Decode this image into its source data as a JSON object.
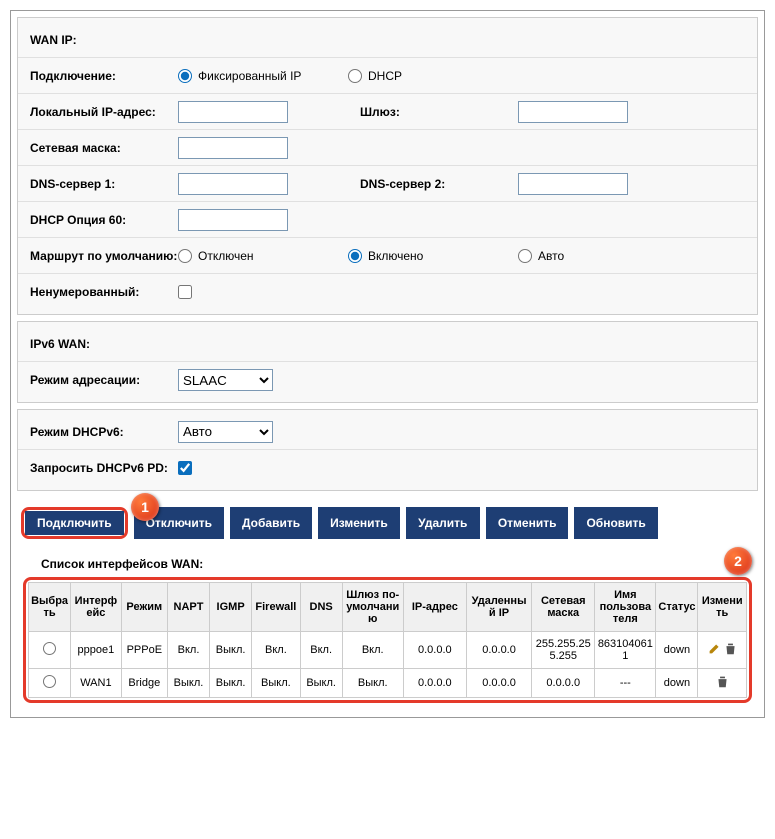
{
  "wanip": {
    "title": "WAN IP:",
    "connection_label": "Подключение:",
    "connection_options": {
      "fixed": "Фиксированный IP",
      "dhcp": "DHCP"
    },
    "connection_value": "fixed",
    "local_ip_label": "Локальный IP-адрес:",
    "local_ip": "",
    "gateway_label": "Шлюз:",
    "gateway": "",
    "netmask_label": "Сетевая маска:",
    "netmask": "",
    "dns1_label": "DNS-сервер 1:",
    "dns1": "",
    "dns2_label": "DNS-сервер 2:",
    "dns2": "",
    "opt60_label": "DHCP Опция 60:",
    "opt60": "",
    "defroute_label": "Маршрут по умолчанию:",
    "defroute_options": {
      "off": "Отключен",
      "on": "Включено",
      "auto": "Авто"
    },
    "defroute_value": "on",
    "unnumbered_label": "Ненумерованный:",
    "unnumbered": false
  },
  "ipv6wan": {
    "title": "IPv6 WAN:",
    "addrmode_label": "Режим адресации:",
    "addrmode": "SLAAC"
  },
  "dhcpv6": {
    "mode_label": "Режим DHCPv6:",
    "mode": "Авто",
    "pd_label": "Запросить DHCPv6 PD:",
    "pd": true
  },
  "buttons": {
    "connect": "Подключить",
    "disconnect": "Отключить",
    "add": "Добавить",
    "modify": "Изменить",
    "delete": "Удалить",
    "cancel": "Отменить",
    "refresh": "Обновить"
  },
  "markers": {
    "one": "1",
    "two": "2"
  },
  "wanlist": {
    "title": "Список интерфейсов WAN:",
    "headers": {
      "select": "Выбрать",
      "iface": "Интерфейс",
      "mode": "Режим",
      "napt": "NAPT",
      "igmp": "IGMP",
      "firewall": "Firewall",
      "dns": "DNS",
      "gateway": "Шлюз по-умолчанию",
      "ip": "IP-адрес",
      "remote_ip": "Удаленный IP",
      "netmask": "Сетевая маска",
      "username": "Имя пользователя",
      "status": "Статус",
      "edit": "Изменить"
    },
    "rows": [
      {
        "iface": "pppoe1",
        "mode": "PPPoE",
        "napt": "Вкл.",
        "igmp": "Выкл.",
        "firewall": "Вкл.",
        "dns": "Вкл.",
        "gateway": "Вкл.",
        "ip": "0.0.0.0",
        "remote_ip": "0.0.0.0",
        "netmask": "255.255.255.255",
        "username": "8631040611",
        "status": "down",
        "editable": true
      },
      {
        "iface": "WAN1",
        "mode": "Bridge",
        "napt": "Выкл.",
        "igmp": "Выкл.",
        "firewall": "Выкл.",
        "dns": "Выкл.",
        "gateway": "Выкл.",
        "ip": "0.0.0.0",
        "remote_ip": "0.0.0.0",
        "netmask": "0.0.0.0",
        "username": "---",
        "status": "down",
        "editable": false
      }
    ]
  }
}
